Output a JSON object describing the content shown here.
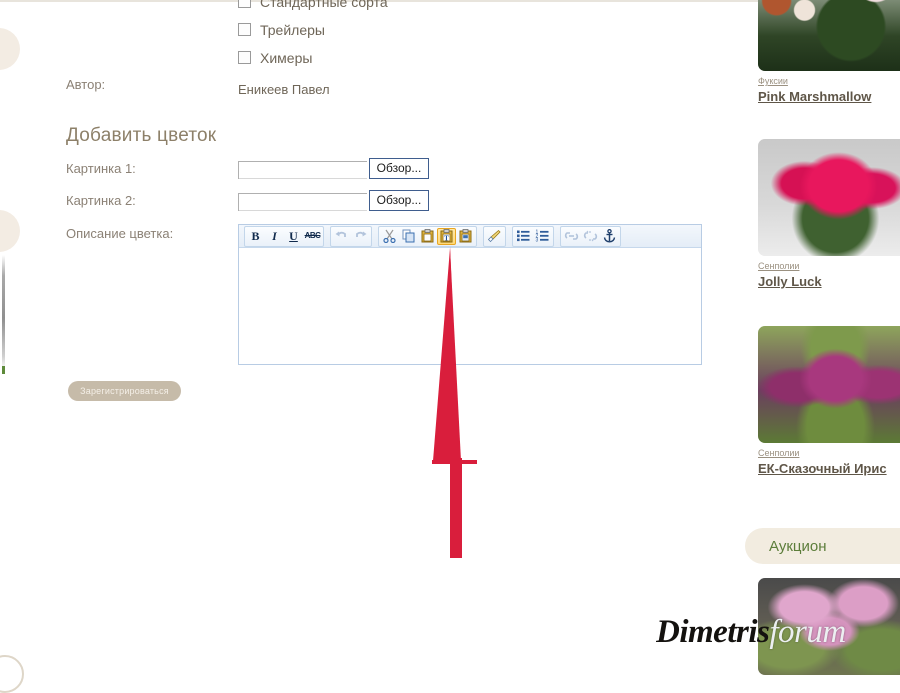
{
  "form": {
    "checkboxes": [
      {
        "label": "Стандартные сорта",
        "checked": false
      },
      {
        "label": "Трейлеры",
        "checked": false
      },
      {
        "label": "Химеры",
        "checked": false
      }
    ],
    "author_label": "Автор:",
    "author_value": "Еникеев Павел",
    "section_title": "Добавить цветок",
    "picture1_label": "Картинка 1:",
    "picture2_label": "Картинка 2:",
    "picture1_value": "",
    "picture2_value": "",
    "browse_label": "Обзор...",
    "description_label": "Описание цветка:",
    "description_value": "",
    "submit_label": "Зарегистрироваться"
  },
  "editor": {
    "toolbar_groups": [
      {
        "buttons": [
          {
            "name": "bold-icon",
            "glyph": "B",
            "kind": "text-b",
            "state": "enabled"
          },
          {
            "name": "italic-icon",
            "glyph": "I",
            "kind": "text-i",
            "state": "enabled"
          },
          {
            "name": "underline-icon",
            "glyph": "U",
            "kind": "text-u",
            "state": "enabled"
          },
          {
            "name": "strikethrough-icon",
            "glyph": "ABC",
            "kind": "text-s",
            "state": "enabled"
          }
        ]
      },
      {
        "buttons": [
          {
            "name": "undo-icon",
            "glyph": "↺",
            "kind": "undo",
            "state": "disabled"
          },
          {
            "name": "redo-icon",
            "glyph": "↻",
            "kind": "redo",
            "state": "disabled"
          }
        ]
      },
      {
        "buttons": [
          {
            "name": "cut-icon",
            "glyph": "✂",
            "kind": "cut",
            "state": "enabled"
          },
          {
            "name": "copy-icon",
            "glyph": "⧉",
            "kind": "copy",
            "state": "enabled"
          },
          {
            "name": "paste-icon",
            "glyph": "📋",
            "kind": "paste",
            "state": "enabled"
          },
          {
            "name": "paste-from-word-icon",
            "glyph": "W",
            "kind": "paste-word",
            "state": "highlighted"
          },
          {
            "name": "paste-as-plain-text-icon",
            "glyph": "T",
            "kind": "paste-plain",
            "state": "enabled"
          }
        ]
      },
      {
        "buttons": [
          {
            "name": "remove-format-icon",
            "glyph": "🖌",
            "kind": "brush",
            "state": "enabled"
          }
        ]
      },
      {
        "buttons": [
          {
            "name": "bulleted-list-icon",
            "glyph": "☰",
            "kind": "ul",
            "state": "enabled"
          },
          {
            "name": "numbered-list-icon",
            "glyph": "☰",
            "kind": "ol",
            "state": "enabled"
          }
        ]
      },
      {
        "buttons": [
          {
            "name": "link-icon",
            "glyph": "🔗",
            "kind": "link",
            "state": "disabled"
          },
          {
            "name": "unlink-icon",
            "glyph": "⛓",
            "kind": "unlink",
            "state": "disabled"
          },
          {
            "name": "anchor-icon",
            "glyph": "⚓",
            "kind": "anchor",
            "state": "enabled"
          }
        ]
      }
    ]
  },
  "sidebar": {
    "cards": [
      {
        "category": "Фуксии",
        "name": "Pink Marshmallow",
        "photo": "ph-fuchsia"
      },
      {
        "category": "Сенполии",
        "name": "Jolly Luck",
        "photo": "ph-violet-pink"
      },
      {
        "category": "Сенполии",
        "name": "ЕК-Сказочный Ирис",
        "photo": "ph-violet-ruffle"
      }
    ],
    "section_heading": "Аукцион",
    "auction_photo": "ph-auction"
  },
  "annotation": {
    "arrow_color": "#d91e3c",
    "points_at": "paste-from-word-icon"
  },
  "watermark": {
    "text_bold": "Dimetris",
    "text_soft": "forum"
  },
  "colors": {
    "accent_beige": "#f2ece0",
    "heading_green": "#5c7d3a",
    "label_brown": "#8b8175",
    "toolbar_blue": "#b8cce4",
    "arrow_red": "#d91e3c"
  }
}
